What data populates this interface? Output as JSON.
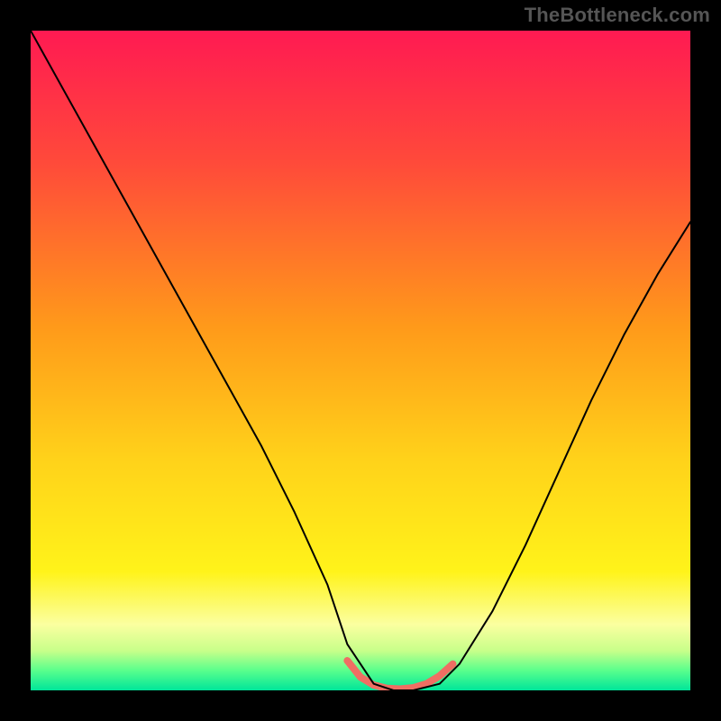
{
  "watermark": "TheBottleneck.com",
  "chart_data": {
    "type": "line",
    "title": "",
    "xlabel": "",
    "ylabel": "",
    "xlim": [
      0,
      100
    ],
    "ylim": [
      0,
      100
    ],
    "gradient_stops": [
      {
        "offset": 0.0,
        "color": "#ff1a52"
      },
      {
        "offset": 0.2,
        "color": "#ff4a3a"
      },
      {
        "offset": 0.45,
        "color": "#ff9a1a"
      },
      {
        "offset": 0.65,
        "color": "#ffd21a"
      },
      {
        "offset": 0.82,
        "color": "#fff31a"
      },
      {
        "offset": 0.9,
        "color": "#fbffa0"
      },
      {
        "offset": 0.94,
        "color": "#c8ff8a"
      },
      {
        "offset": 0.97,
        "color": "#59ff8c"
      },
      {
        "offset": 1.0,
        "color": "#00e59a"
      }
    ],
    "series": [
      {
        "name": "curve",
        "color": "#000000",
        "width": 2.0,
        "x": [
          0,
          5,
          10,
          15,
          20,
          25,
          30,
          35,
          40,
          45,
          48,
          52,
          55,
          58,
          62,
          65,
          70,
          75,
          80,
          85,
          90,
          95,
          100
        ],
        "y": [
          100,
          91,
          82,
          73,
          64,
          55,
          46,
          37,
          27,
          16,
          7,
          1,
          0,
          0,
          1,
          4,
          12,
          22,
          33,
          44,
          54,
          63,
          71
        ]
      },
      {
        "name": "valley-highlight",
        "color": "#ef6e63",
        "width": 8.0,
        "x": [
          48,
          50,
          52,
          54,
          56,
          58,
          60,
          62,
          64
        ],
        "y": [
          4.5,
          2.0,
          0.8,
          0.3,
          0.2,
          0.4,
          1.0,
          2.2,
          4.0
        ]
      }
    ],
    "annotations": []
  }
}
